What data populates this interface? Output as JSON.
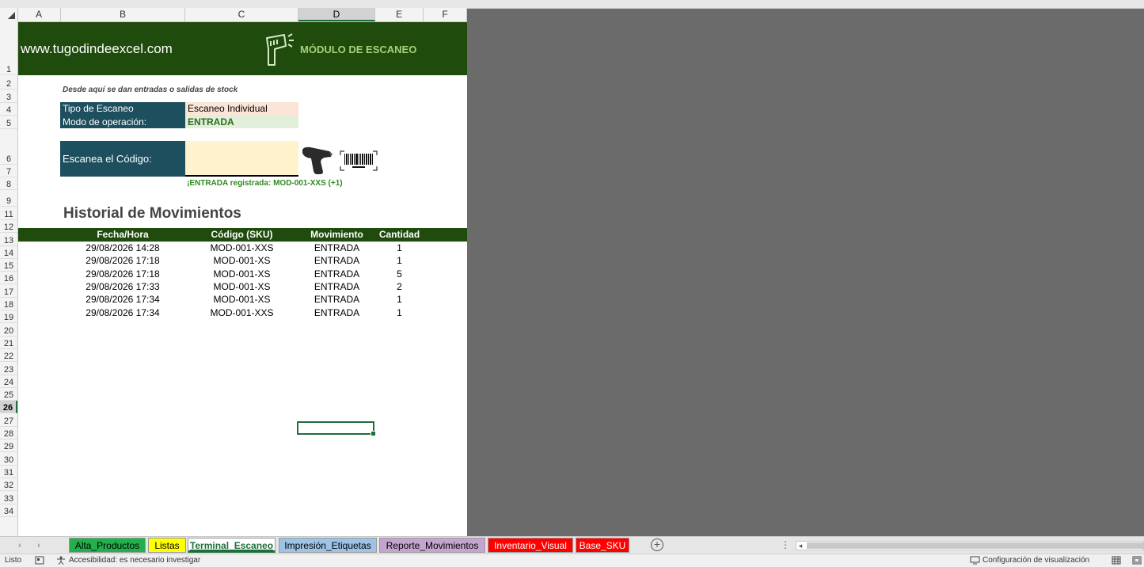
{
  "columns": [
    "A",
    "B",
    "C",
    "D",
    "E",
    "F"
  ],
  "selected_column": "D",
  "rows": [
    "1",
    "2",
    "3",
    "4",
    "5",
    "6",
    "7",
    "8",
    "9",
    "11",
    "12",
    "13",
    "14",
    "15",
    "16",
    "17",
    "18",
    "19",
    "20",
    "21",
    "22",
    "23",
    "24",
    "25",
    "26",
    "27",
    "28",
    "29",
    "30",
    "31",
    "32",
    "33",
    "34"
  ],
  "selected_row": "26",
  "header": {
    "site": "www.tugodindeexcel.com",
    "module_title": "MÓDULO DE ESCANEO",
    "module_icon": "barcode-scanner-gun-icon"
  },
  "subtitle": "Desde aquí se dan entradas o salidas de stock",
  "scan_type": {
    "label": "Tipo de Escaneo",
    "value": "Escaneo Individual"
  },
  "operation_mode": {
    "label": "Modo de operación:",
    "value": "ENTRADA"
  },
  "scan_input": {
    "label": "Escanea el Código:",
    "value": ""
  },
  "status_message": "¡ENTRADA registrada: MOD-001-XXS (+1)",
  "history": {
    "title": "Historial de Movimientos",
    "columns": [
      "Fecha/Hora",
      "Código (SKU)",
      "Movimiento",
      "Cantidad"
    ],
    "rows": [
      [
        "29/08/2026 14:28",
        "MOD-001-XXS",
        "ENTRADA",
        "1"
      ],
      [
        "29/08/2026 17:18",
        "MOD-001-XS",
        "ENTRADA",
        "1"
      ],
      [
        "29/08/2026 17:18",
        "MOD-001-XS",
        "ENTRADA",
        "5"
      ],
      [
        "29/08/2026 17:33",
        "MOD-001-XS",
        "ENTRADA",
        "2"
      ],
      [
        "29/08/2026 17:34",
        "MOD-001-XS",
        "ENTRADA",
        "1"
      ],
      [
        "29/08/2026 17:34",
        "MOD-001-XXS",
        "ENTRADA",
        "1"
      ]
    ]
  },
  "sheet_tabs": [
    {
      "label": "Alta_Productos",
      "color": "#21b04b",
      "text": "#000000"
    },
    {
      "label": "Listas",
      "color": "#ffff00",
      "text": "#000000"
    },
    {
      "label": "Terminal_Escaneo",
      "color": "#ffffff",
      "text": "#1e6e3c",
      "active": true
    },
    {
      "label": "Impresión_Etiquetas",
      "color": "#9dc3e6",
      "text": "#000000"
    },
    {
      "label": "Reporte_Movimientos",
      "color": "#c5a5cf",
      "text": "#000000"
    },
    {
      "label": "Inventario_Visual",
      "color": "#ff0000",
      "text": "#ffffff"
    },
    {
      "label": "Base_SKU",
      "color": "#ff0000",
      "text": "#ffffff"
    }
  ],
  "status_bar": {
    "ready": "Listo",
    "accessibility": "Accesibilidad: es necesario investigar",
    "view_settings": "Configuración de visualización"
  },
  "colors": {
    "banner": "#1f4b0c",
    "label_bg": "#1e4f5e",
    "accent_green": "#1e6e3c",
    "sheet_bg_outside": "#6b6b6b"
  }
}
